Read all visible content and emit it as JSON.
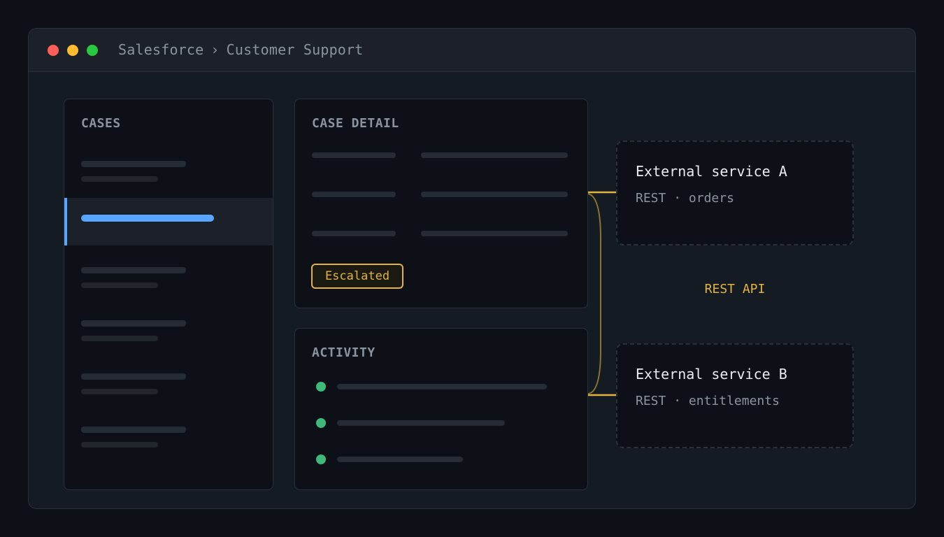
{
  "window": {
    "breadcrumb": [
      "Salesforce",
      "Customer Support"
    ],
    "breadcrumb_separator": "›",
    "controls": {
      "close_color": "#ff5f57",
      "minimize_color": "#febc2e",
      "maximize_color": "#28c840"
    }
  },
  "cases_panel": {
    "title": "CASES",
    "selected_index": 1,
    "item_count": 6
  },
  "case_detail": {
    "title": "CASE DETAIL",
    "status_badge": "Escalated"
  },
  "activity": {
    "title": "ACTIVITY",
    "item_count": 3
  },
  "connection": {
    "label": "REST API",
    "color": "#e3b341"
  },
  "external_services": [
    {
      "name": "External service A",
      "protocol": "REST",
      "separator": "·",
      "resource": "orders"
    },
    {
      "name": "External service B",
      "protocol": "REST",
      "separator": "·",
      "resource": "entitlements"
    }
  ],
  "colors": {
    "accent": "#58a6ff",
    "warning": "#e3b341",
    "success": "#3fb97a"
  }
}
